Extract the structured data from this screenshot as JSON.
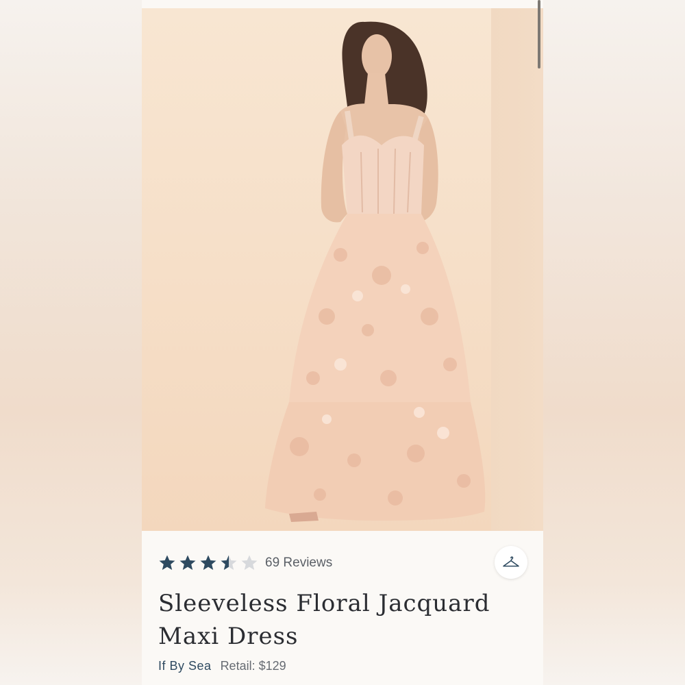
{
  "product": {
    "rating": 3.5,
    "max_rating": 5,
    "reviews_label": "69 Reviews",
    "title": "Sleeveless Floral Jacquard Maxi Dress",
    "brand": "If By Sea",
    "retail": "Retail: $129"
  },
  "icons": {
    "hanger": "hanger-icon",
    "star": "star-icon"
  },
  "colors": {
    "star_filled": "#2e4a60",
    "star_empty": "#d7d9dc",
    "brand": "#2e4a60"
  }
}
